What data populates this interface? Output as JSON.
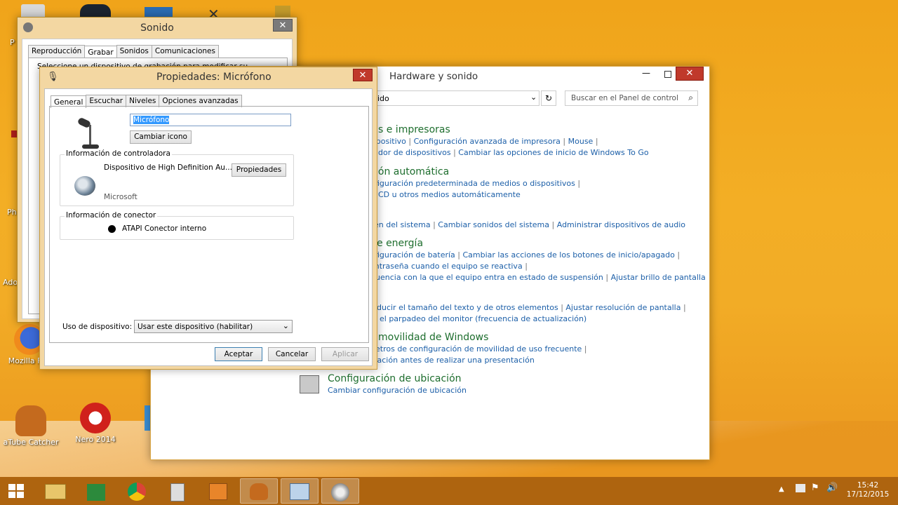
{
  "desktop": {
    "icons": [
      {
        "label": "Mozilla Fi..."
      },
      {
        "label": "aTube Catcher"
      },
      {
        "label": "Nero 2014"
      }
    ],
    "left_fragments": [
      "P",
      "Ph",
      "Ado"
    ]
  },
  "sonido_window": {
    "title": "Sonido",
    "tabs": [
      "Reproducción",
      "Grabar",
      "Sonidos",
      "Comunicaciones"
    ],
    "active_tab": "Grabar",
    "text_fragment": "Seleccione un dispositivo de grabación para modificar su"
  },
  "properties_dialog": {
    "title": "Propiedades: Micrófono",
    "tabs": [
      "General",
      "Escuchar",
      "Niveles",
      "Opciones avanzadas"
    ],
    "name_value": "Micrófono",
    "change_icon_label": "Cambiar icono",
    "controller_group_title": "Información de controladora",
    "controller_device": "Dispositivo de High Definition Au...",
    "controller_vendor": "Microsoft",
    "properties_button": "Propiedades",
    "connector_group_title": "Información de conector",
    "connector_value": "ATAPI Conector interno",
    "device_usage_label": "Uso de dispositivo:",
    "device_usage_value": "Usar este dispositivo (habilitar)",
    "ok_label": "Aceptar",
    "cancel_label": "Cancelar",
    "apply_label": "Aplicar"
  },
  "control_panel": {
    "title": "Hardware y sonido",
    "address_text": "ido",
    "search_placeholder": "Buscar en el Panel de control",
    "sections": [
      {
        "heading": "s e impresoras",
        "lines": [
          [
            "ispositivo",
            "Configuración avanzada de impresora",
            "Mouse"
          ],
          [
            "dor de dispositivos",
            "Cambiar las opciones de inicio de Windows To Go"
          ]
        ]
      },
      {
        "heading": "ión automática",
        "lines": [
          [
            "nfiguración predeterminada de medios o dispositivos"
          ],
          [
            "CD u otros medios automáticamente"
          ]
        ]
      },
      {
        "heading": "",
        "lines": [
          [
            "en del sistema",
            "Cambiar sonidos del sistema",
            "Administrar dispositivos de audio"
          ]
        ]
      },
      {
        "heading": "e energía",
        "lines": [
          [
            "nfiguración de batería",
            "Cambiar las acciones de los botones de inicio/apagado"
          ],
          [
            "ontraseña cuando el equipo se reactiva"
          ],
          [
            "cuencia con la que el equipo entra en estado de suspensión",
            "Ajustar brillo de pantalla"
          ]
        ]
      },
      {
        "heading": "",
        "lines": [
          [
            "ducir el tamaño del texto y de otros elementos",
            "Ajustar resolución de pantalla"
          ],
          [
            "el parpadeo del monitor (frecuencia de actualización)"
          ]
        ]
      },
      {
        "heading": "movilidad de Windows",
        "lines": [
          [
            "etros de configuración de movilidad de uso frecuente"
          ],
          [
            "ración antes de realizar una presentación"
          ]
        ]
      }
    ],
    "location": {
      "heading": "Configuración de ubicación",
      "link": "Cambiar configuración de ubicación"
    }
  },
  "taskbar": {
    "time": "15:42",
    "date": "17/12/2015"
  },
  "colors": {
    "accent": "#f0a41a",
    "close": "#c0392b",
    "link": "#1c5fa8",
    "heading": "#1e6e2e"
  }
}
